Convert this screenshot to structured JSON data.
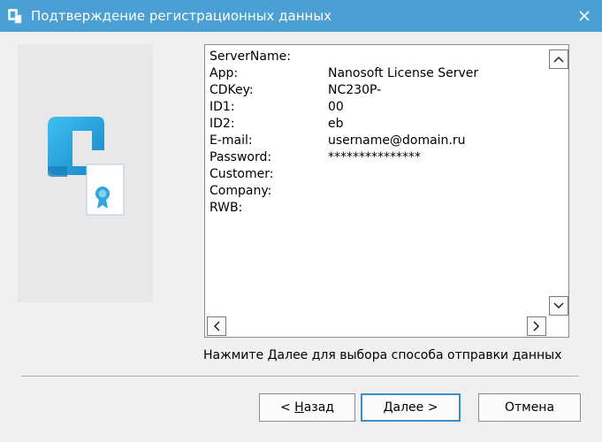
{
  "window": {
    "title": "Подтверждение регистрационных данных",
    "icons": {
      "app": "app-logo-icon",
      "close": "close-icon"
    }
  },
  "registration": {
    "fields": [
      {
        "key": "ServerName:",
        "value": ""
      },
      {
        "key": "App:",
        "value": "Nanosoft License Server"
      },
      {
        "key": "CDKey:",
        "value": "NC230P-"
      },
      {
        "key": "ID1:",
        "value": "00"
      },
      {
        "key": "ID2:",
        "value": "eb"
      },
      {
        "key": "E-mail:",
        "value": "username@domain.ru"
      },
      {
        "key": "Password:",
        "value": "***************"
      },
      {
        "key": "Customer:",
        "value": ""
      },
      {
        "key": "Company:",
        "value": ""
      },
      {
        "key": "RWB:",
        "value": ""
      }
    ]
  },
  "hint": "Нажмите Далее для выбора способа отправки данных",
  "buttons": {
    "back_prefix": "< ",
    "back_mnemonic": "Н",
    "back_rest": "азад",
    "next_mnemonic": "Д",
    "next_rest": "алее >",
    "cancel": "Отмена"
  },
  "colors": {
    "titlebar": "#4a9fd4",
    "logo_primary": "#2aa6e0",
    "logo_dark": "#1c7fbf",
    "focus_border": "#3d8bd0"
  }
}
